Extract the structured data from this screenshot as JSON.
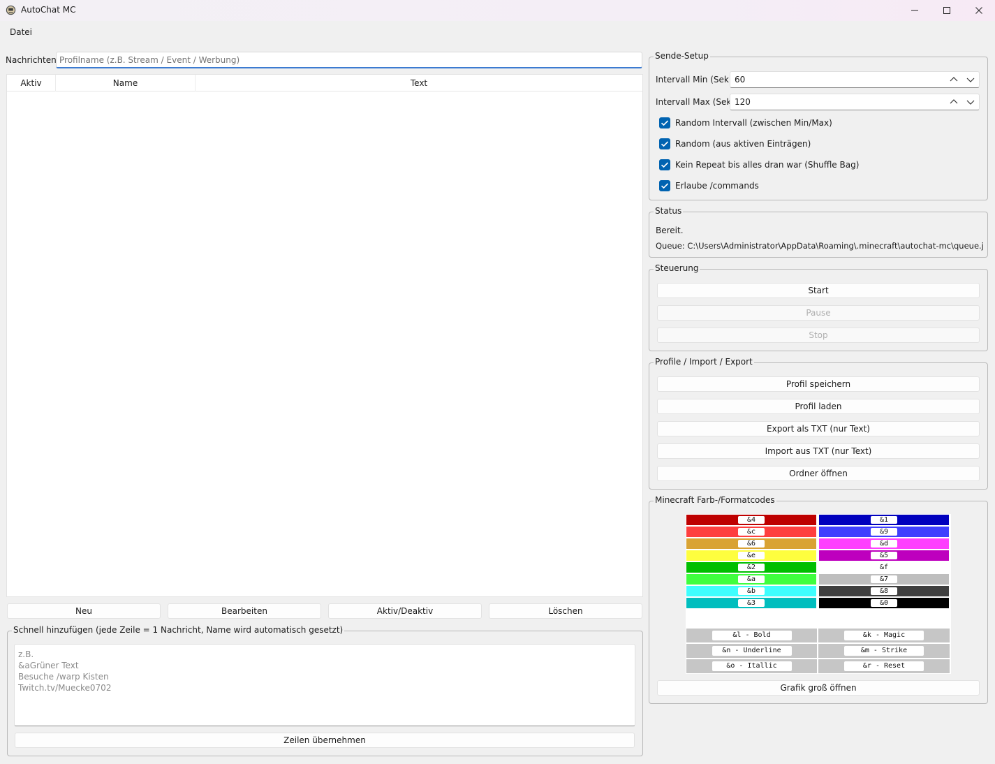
{
  "window": {
    "title": "AutoChat MC"
  },
  "menu": {
    "file": "Datei"
  },
  "messages": {
    "label": "Nachrichten",
    "profile_placeholder": "Profilname (z.B. Stream / Event / Werbung)",
    "columns": [
      "Aktiv",
      "Name",
      "Text"
    ],
    "buttons": {
      "new": "Neu",
      "edit": "Bearbeiten",
      "toggle": "Aktiv/Deaktiv",
      "delete": "Löschen"
    }
  },
  "quick_add": {
    "title": "Schnell hinzufügen (jede Zeile = 1 Nachricht, Name wird automatisch gesetzt)",
    "placeholder": "z.B.\n&aGrüner Text\nBesuche /warp Kisten\nTwitch.tv/Muecke0702",
    "apply": "Zeilen übernehmen"
  },
  "send_setup": {
    "title": "Sende-Setup",
    "interval_min_label": "Intervall Min (Sek.)",
    "interval_min_value": "60",
    "interval_max_label": "Intervall Max (Sek.)",
    "interval_max_value": "120",
    "options": [
      {
        "label": "Random Intervall (zwischen Min/Max)",
        "checked": true
      },
      {
        "label": "Random (aus aktiven Einträgen)",
        "checked": true
      },
      {
        "label": "Kein Repeat bis alles dran war (Shuffle Bag)",
        "checked": true
      },
      {
        "label": "Erlaube /commands",
        "checked": true
      }
    ]
  },
  "status": {
    "title": "Status",
    "state": "Bereit.",
    "queue": "Queue: C:\\Users\\Administrator\\AppData\\Roaming\\.minecraft\\autochat-mc\\queue.jsonl"
  },
  "control": {
    "title": "Steuerung",
    "start": "Start",
    "pause": "Pause",
    "stop": "Stop"
  },
  "profiles": {
    "title": "Profile / Import / Export",
    "save": "Profil speichern",
    "load": "Profil laden",
    "export": "Export als TXT (nur Text)",
    "import": "Import aus TXT (nur Text)",
    "open_folder": "Ordner öffnen"
  },
  "codes": {
    "title": "Minecraft Farb-/Formatcodes",
    "left": [
      {
        "code": "&4",
        "color": "#be0000"
      },
      {
        "code": "&c",
        "color": "#fe3f3f"
      },
      {
        "code": "&6",
        "color": "#d9a334"
      },
      {
        "code": "&e",
        "color": "#fefe3f"
      },
      {
        "code": "&2",
        "color": "#00be00"
      },
      {
        "code": "&a",
        "color": "#3ffe3f"
      },
      {
        "code": "&b",
        "color": "#3ffefe"
      },
      {
        "code": "&3",
        "color": "#00bebe"
      }
    ],
    "right": [
      {
        "code": "&1",
        "color": "#0000be"
      },
      {
        "code": "&9",
        "color": "#3f3ffe"
      },
      {
        "code": "&d",
        "color": "#fe3ffe"
      },
      {
        "code": "&5",
        "color": "#be00be"
      },
      {
        "code": "&f",
        "color": "#ffffff"
      },
      {
        "code": "&7",
        "color": "#bebebe"
      },
      {
        "code": "&8",
        "color": "#3f3f3f"
      },
      {
        "code": "&0",
        "color": "#000000"
      }
    ],
    "formats": [
      [
        "&l - Bold",
        "&k - Magic"
      ],
      [
        "&n - Underline",
        "&m - Strike"
      ],
      [
        "&o - Itallic",
        "&r - Reset"
      ]
    ],
    "open_large": "Grafik groß öffnen"
  }
}
